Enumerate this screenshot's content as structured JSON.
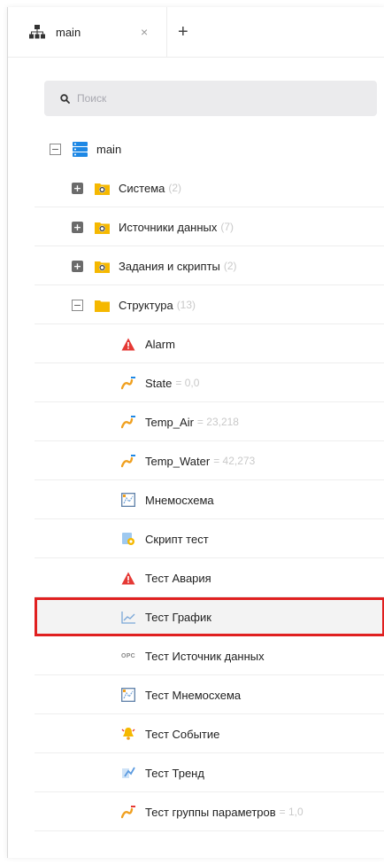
{
  "tabs": [
    {
      "label": "main",
      "icon": "network-tree-icon",
      "close": "×"
    }
  ],
  "tab_add": "+",
  "search": {
    "placeholder": "Поиск",
    "icon": "search-icon"
  },
  "tree": {
    "root": {
      "label": "main",
      "icon": "server-stack-icon",
      "toggle": "−"
    },
    "items": [
      {
        "label": "Система",
        "count": "(2)",
        "toggle": "+",
        "icon": "folder-gear-icon"
      },
      {
        "label": "Источники данных",
        "count": "(7)",
        "toggle": "+",
        "icon": "folder-gear-icon"
      },
      {
        "label": "Задания и скрипты",
        "count": "(2)",
        "toggle": "+",
        "icon": "folder-gear-icon"
      },
      {
        "label": "Структура",
        "count": "(13)",
        "toggle": "−",
        "icon": "folder-icon",
        "children": [
          {
            "label": "Alarm",
            "suffix": "",
            "icon": "alarm-triangle-icon"
          },
          {
            "label": "State",
            "suffix": "= 0,0",
            "icon": "parameter-icon"
          },
          {
            "label": "Temp_Air",
            "suffix": "= 23,218",
            "icon": "parameter-icon"
          },
          {
            "label": "Temp_Water",
            "suffix": "= 42,273",
            "icon": "parameter-icon"
          },
          {
            "label": "Мнемосхема",
            "suffix": "",
            "icon": "mnemonic-diagram-icon"
          },
          {
            "label": "Скрипт тест",
            "suffix": "",
            "icon": "script-icon"
          },
          {
            "label": "Тест Авария",
            "suffix": "",
            "icon": "alarm-triangle-icon"
          },
          {
            "label": "Тест График",
            "suffix": "",
            "icon": "line-chart-icon",
            "selected": true
          },
          {
            "label": "Тест Источник данных",
            "suffix": "",
            "icon": "opc-icon",
            "icon_text": "OPC"
          },
          {
            "label": "Тест Мнемосхема",
            "suffix": "",
            "icon": "mnemonic-diagram-icon"
          },
          {
            "label": "Тест Событие",
            "suffix": "",
            "icon": "event-bell-icon"
          },
          {
            "label": "Тест Тренд",
            "suffix": "",
            "icon": "trend-icon"
          },
          {
            "label": "Тест группы параметров",
            "suffix": "= 1,0",
            "icon": "parameter-icon"
          }
        ]
      }
    ]
  },
  "colors": {
    "selection_outline": "#e02020",
    "folder": "#f5b800",
    "server": "#1e88e5",
    "alarm": "#e53935"
  }
}
